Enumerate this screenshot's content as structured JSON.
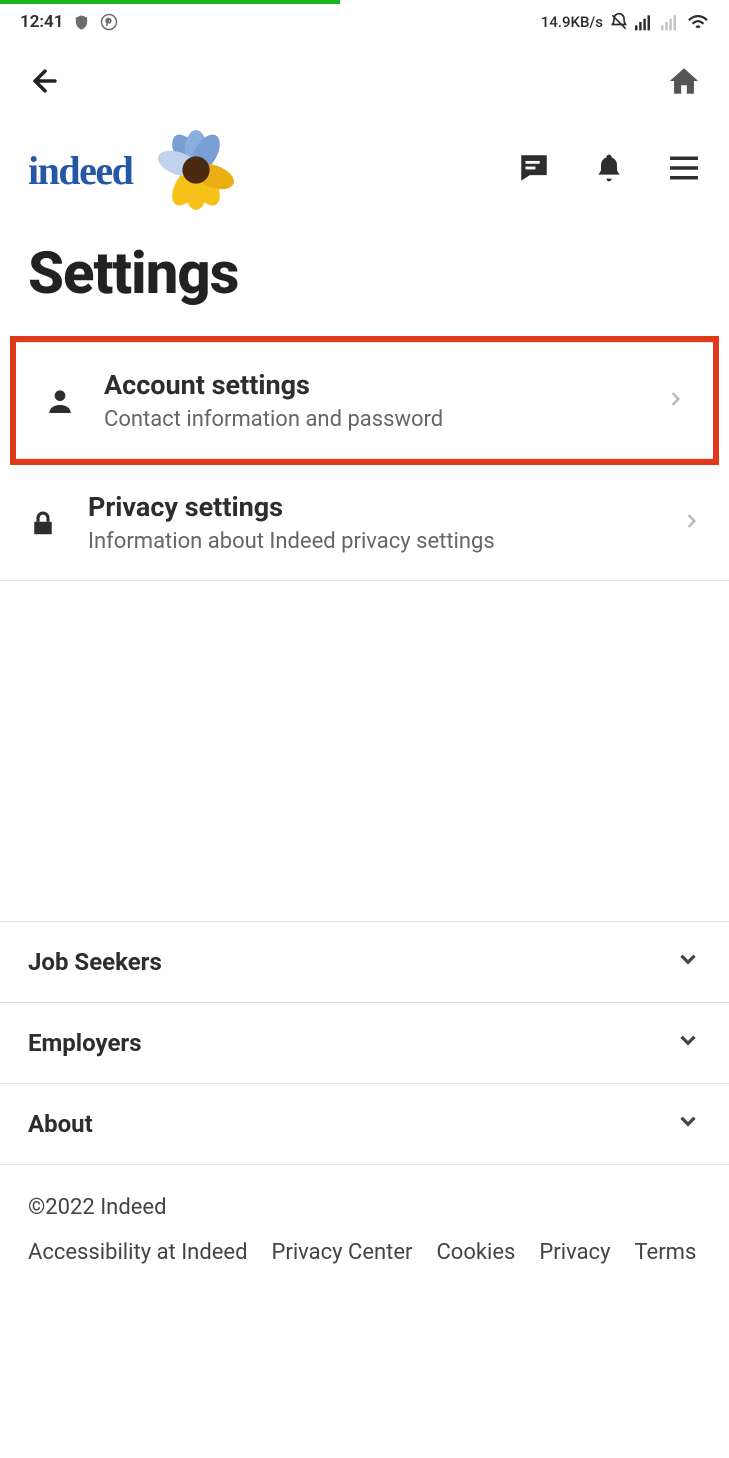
{
  "statusbar": {
    "time": "12:41",
    "net_speed": "14.9KB/s"
  },
  "page": {
    "title": "Settings"
  },
  "brand": {
    "name": "indeed"
  },
  "settings": [
    {
      "title": "Account settings",
      "desc": "Contact information and password"
    },
    {
      "title": "Privacy settings",
      "desc": "Information about Indeed privacy settings"
    }
  ],
  "footer_sections": [
    {
      "label": "Job Seekers"
    },
    {
      "label": "Employers"
    },
    {
      "label": "About"
    }
  ],
  "legal": {
    "copyright": "©2022 Indeed",
    "links": [
      "Accessibility at Indeed",
      "Privacy Center",
      "Cookies",
      "Privacy",
      "Terms"
    ]
  }
}
